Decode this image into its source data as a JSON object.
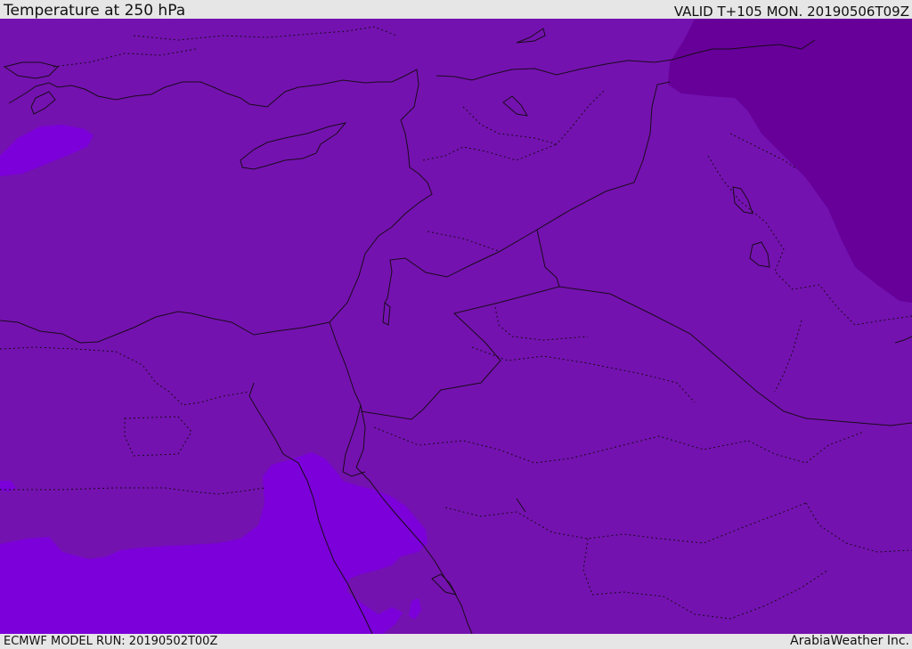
{
  "header": {
    "title": "Temperature at 250 hPa",
    "valid": "VALID T+105 MON. 20190506T09Z"
  },
  "footer": {
    "model_run": "ECMWF MODEL RUN: 20190502T00Z",
    "credit": "ArabiaWeather Inc."
  },
  "map": {
    "colors": {
      "base": "#7412b0",
      "warm": "#7b00d9",
      "cold": "#660099",
      "coast": "#1a0a1a"
    }
  }
}
